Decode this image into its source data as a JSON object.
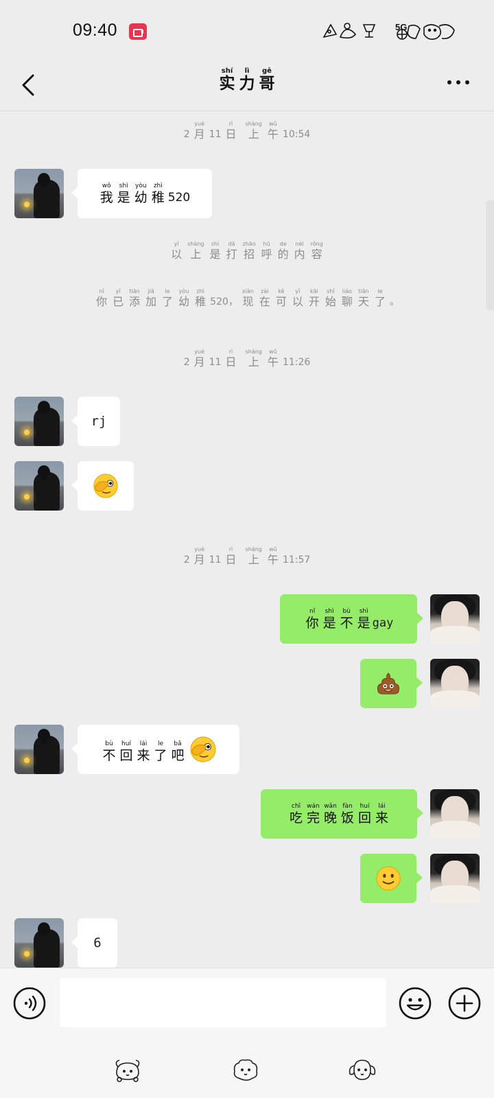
{
  "status_bar": {
    "time": "09:40",
    "network": "5G",
    "icons": [
      "screen-record-icon",
      "wifi-icon",
      "signal-icon",
      "battery-icon"
    ]
  },
  "header": {
    "title": [
      {
        "h": "实",
        "r": "shí"
      },
      {
        "h": "力",
        "r": "lì"
      },
      {
        "h": "哥",
        "r": "gē"
      }
    ],
    "back_icon": "chevron-left-icon",
    "more_icon": "more-dots-icon"
  },
  "timestamps": [
    {
      "month": "2",
      "m": "月",
      "m_r": "yuè",
      "day": "11",
      "d": "日",
      "d_r": "rì",
      "a1": "上",
      "a1_r": "shàng",
      "a2": "午",
      "a2_r": "wǔ",
      "time": "10:54"
    },
    {
      "month": "2",
      "m": "月",
      "m_r": "yuè",
      "day": "11",
      "d": "日",
      "d_r": "rì",
      "a1": "上",
      "a1_r": "shàng",
      "a2": "午",
      "a2_r": "wǔ",
      "time": "11:26"
    },
    {
      "month": "2",
      "m": "月",
      "m_r": "yuè",
      "day": "11",
      "d": "日",
      "d_r": "rì",
      "a1": "上",
      "a1_r": "shàng",
      "a2": "午",
      "a2_r": "wǔ",
      "time": "11:57"
    }
  ],
  "system_notes": {
    "greeting": [
      {
        "h": "以",
        "r": "yǐ"
      },
      {
        "h": "上",
        "r": "shàng"
      },
      {
        "h": "是",
        "r": "shì"
      },
      {
        "h": "打",
        "r": "dǎ"
      },
      {
        "h": "招",
        "r": "zhāo"
      },
      {
        "h": "呼",
        "r": "hū"
      },
      {
        "h": "的",
        "r": "de"
      },
      {
        "h": "内",
        "r": "nèi"
      },
      {
        "h": "容",
        "r": "róng"
      }
    ],
    "added_a": [
      {
        "h": "你",
        "r": "nǐ"
      },
      {
        "h": "已",
        "r": "yǐ"
      },
      {
        "h": "添",
        "r": "tiān"
      },
      {
        "h": "加",
        "r": "jiā"
      },
      {
        "h": "了",
        "r": "le"
      },
      {
        "h": "幼",
        "r": "yòu"
      },
      {
        "h": "稚",
        "r": "zhì"
      }
    ],
    "added_num": "520，",
    "added_b": [
      {
        "h": "现",
        "r": "xiàn"
      },
      {
        "h": "在",
        "r": "zài"
      },
      {
        "h": "可",
        "r": "kě"
      },
      {
        "h": "以",
        "r": "yǐ"
      },
      {
        "h": "开",
        "r": "kāi"
      },
      {
        "h": "始",
        "r": "shǐ"
      },
      {
        "h": "聊",
        "r": "liáo"
      },
      {
        "h": "天",
        "r": "tiān"
      },
      {
        "h": "了",
        "r": "le"
      }
    ],
    "added_end": "。"
  },
  "messages": {
    "m1": {
      "chars": [
        {
          "h": "我",
          "r": "wǒ"
        },
        {
          "h": "是",
          "r": "shì"
        },
        {
          "h": "幼",
          "r": "yòu"
        },
        {
          "h": "稚",
          "r": "zhì"
        }
      ],
      "suffix": "520"
    },
    "m2": {
      "text": "rj"
    },
    "m3": {
      "emoji": "face-covering-eye-emoji"
    },
    "m4": {
      "chars": [
        {
          "h": "你",
          "r": "nǐ"
        },
        {
          "h": "是",
          "r": "shì"
        },
        {
          "h": "不",
          "r": "bù"
        },
        {
          "h": "是",
          "r": "shì"
        }
      ],
      "suffix": "gay"
    },
    "m5": {
      "emoji": "poop-emoji"
    },
    "m6": {
      "chars": [
        {
          "h": "不",
          "r": "bù"
        },
        {
          "h": "回",
          "r": "huí"
        },
        {
          "h": "来",
          "r": "lái"
        },
        {
          "h": "了",
          "r": "le"
        },
        {
          "h": "吧",
          "r": "bā"
        }
      ],
      "emoji": "face-covering-eye-emoji"
    },
    "m7": {
      "chars": [
        {
          "h": "吃",
          "r": "chī"
        },
        {
          "h": "完",
          "r": "wán"
        },
        {
          "h": "晚",
          "r": "wǎn"
        },
        {
          "h": "饭",
          "r": "fàn"
        },
        {
          "h": "回",
          "r": "huí"
        },
        {
          "h": "来",
          "r": "lái"
        }
      ]
    },
    "m8": {
      "emoji": "smile-emoji"
    },
    "m9": {
      "text": "6"
    }
  },
  "input_bar": {
    "placeholder": "",
    "voice_icon": "voice-icon",
    "emoji_icon": "emoji-face-icon",
    "plus_icon": "plus-circle-icon"
  },
  "colors": {
    "background": "#ededed",
    "bubble_self": "#95ec69",
    "bubble_other": "#ffffff",
    "system_text": "#8c8c8c",
    "record_badge": "#e8344e"
  }
}
